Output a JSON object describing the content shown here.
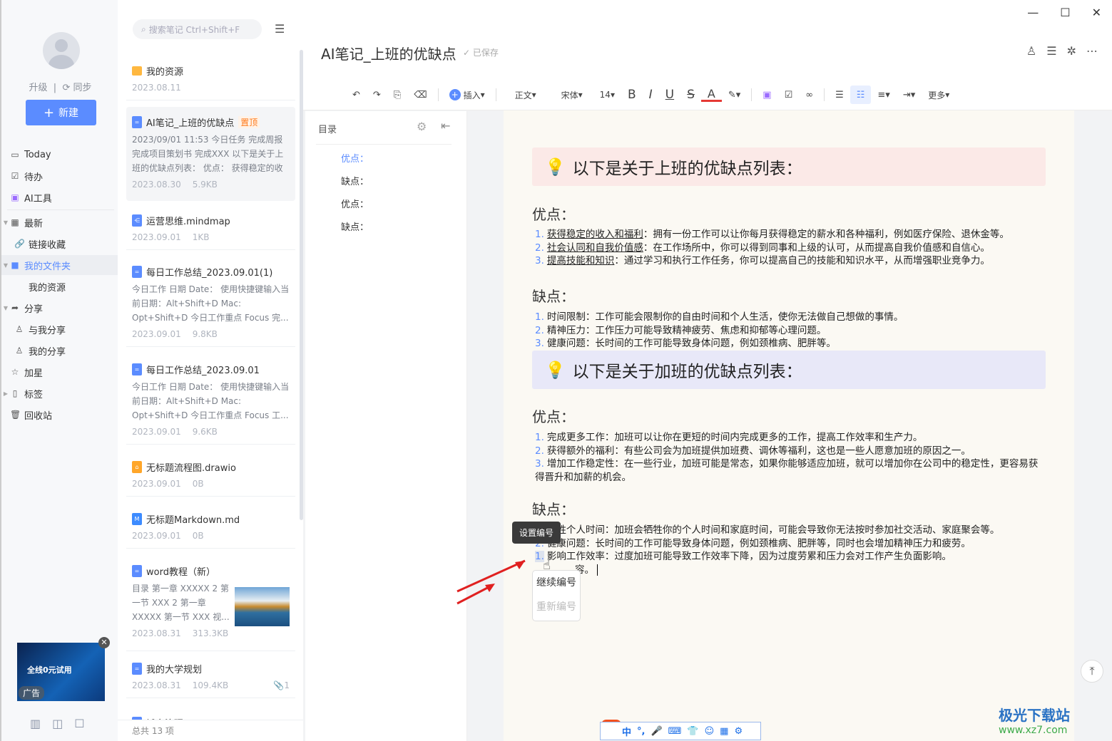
{
  "window": {
    "min": "—",
    "max": "☐",
    "close": "✕"
  },
  "nav": {
    "upgrade": "升级",
    "sync": "同步",
    "new": "新建",
    "items": [
      {
        "label": "Today",
        "icon": "calendar-icon"
      },
      {
        "label": "待办",
        "icon": "checkbox-icon"
      },
      {
        "label": "AI工具",
        "icon": "ai-icon"
      },
      {
        "label": "最新",
        "icon": "grid-icon"
      },
      {
        "label": "链接收藏",
        "icon": "link-icon"
      },
      {
        "label": "我的文件夹",
        "icon": "folder-icon"
      },
      {
        "label": "我的资源",
        "icon": ""
      },
      {
        "label": "分享",
        "icon": "share-icon"
      },
      {
        "label": "与我分享",
        "icon": "user-icon"
      },
      {
        "label": "我的分享",
        "icon": "user-icon"
      },
      {
        "label": "加星",
        "icon": "star-icon"
      },
      {
        "label": "标签",
        "icon": "tag-icon"
      },
      {
        "label": "回收站",
        "icon": "trash-icon"
      }
    ],
    "ad_label": "广告",
    "ad_text": "全线0元试用"
  },
  "list": {
    "search_placeholder": "搜索笔记 Ctrl+Shift+F",
    "footer": "总共 13 项",
    "notes": [
      {
        "title": "我的资源",
        "date": "2023.08.11",
        "size": "",
        "snippet": "",
        "type": "folder"
      },
      {
        "title": "AI笔记_上班的优缺点",
        "badge": "置顶",
        "snippet": "2023/09/01 11:53 今日任务 完成周报 完成项目策划书 完成XXX 以下是关于上班的优缺点列表： 优点： 获得稳定的收入...",
        "date": "2023.08.30",
        "size": "5.9KB",
        "type": "doc"
      },
      {
        "title": "运营思维.mindmap",
        "date": "2023.09.01",
        "size": "1KB",
        "snippet": "",
        "type": "mindmap"
      },
      {
        "title": "每日工作总结_2023.09.01(1)",
        "snippet": "今日工作 日期 Date： 使用快捷键输入当前日期：Alt+Shift+D Mac: Opt+Shift+D 今日工作重点 Focus 完...",
        "date": "2023.09.01",
        "size": "9.8KB",
        "type": "doc"
      },
      {
        "title": "每日工作总结_2023.09.01",
        "snippet": "今日工作 日期 Date： 使用快捷键输入当前日期：Alt+Shift+D Mac: Opt+Shift+D 今日工作重点 Focus 工...",
        "date": "2023.09.01",
        "size": "9.6KB",
        "type": "doc"
      },
      {
        "title": "无标题流程图.drawio",
        "date": "2023.09.01",
        "size": "0B",
        "snippet": "",
        "type": "drawio"
      },
      {
        "title": "无标题Markdown.md",
        "date": "2023.09.01",
        "size": "0B",
        "snippet": "",
        "type": "md"
      },
      {
        "title": "word教程（新）",
        "snippet": "目录 第一章 XXXXX 2 第一节 XXX 2 第一章 XXXXX 第一节 XXX 视...",
        "date": "2023.08.31",
        "size": "313.3KB",
        "type": "doc"
      },
      {
        "title": "我的大学规划",
        "date": "2023.08.31",
        "size": "109.4KB",
        "attach": "1",
        "snippet": "",
        "type": "doc"
      },
      {
        "title": "城市治理",
        "date": "",
        "size": "",
        "snippet": "",
        "type": "doc"
      }
    ]
  },
  "editor": {
    "title": "AI笔记_上班的优缺点",
    "saved": "已保存",
    "toolbar": {
      "insert": "插入",
      "style": "正文",
      "font": "宋体",
      "size": "14",
      "bold": "B",
      "italic": "I",
      "underline": "U",
      "strike": "S",
      "color": "A",
      "more": "更多"
    },
    "toc": {
      "heading": "目录",
      "items": [
        "优点：",
        "缺点：",
        "优点：",
        "缺点："
      ]
    },
    "banner1": "以下是关于上班的优缺点列表：",
    "banner2": "以下是关于加班的优缺点列表：",
    "h_pros": "优点：",
    "h_cons": "缺点：",
    "work_pros": [
      {
        "k": "获得稳定的收入和福利",
        "v": "：拥有一份工作可以让你每月获得稳定的薪水和各种福利，例如医疗保险、退休金等。"
      },
      {
        "k": "社会认同和自我价值感",
        "v": "：在工作场所中，你可以得到同事和上级的认可，从而提高自我价值感和自信心。"
      },
      {
        "k": "提高技能和知识",
        "v": "：通过学习和执行工作任务，你可以提高自己的技能和知识水平，从而增强职业竞争力。"
      }
    ],
    "work_cons": [
      "时间限制：工作可能会限制你的自由时间和个人生活，使你无法做自己想做的事情。",
      "精神压力：工作压力可能导致精神疲劳、焦虑和抑郁等心理问题。",
      "健康问题：长时间的工作可能导致身体问题，例如颈椎病、肥胖等。"
    ],
    "ot_pros": [
      "完成更多工作：加班可以让你在更短的时间内完成更多的工作，提高工作效率和生产力。",
      "获得额外的福利：有些公司会为加班提供加班费、调休等福利，这也是一些人愿意加班的原因之一。",
      "增加工作稳定性：在一些行业，加班可能是常态，如果你能够适应加班，就可以增加你在公司中的稳定性，更容易获得晋升和加薪的机会。"
    ],
    "ot_cons": [
      "牺牲个人时间：加班会牺牲你的个人时间和家庭时间，可能会导致你无法按时参加社交活动、家庭聚会等。",
      "健康问题：长时间的工作可能导致身体问题，例如颈椎病、肥胖等，同时也会增加精神压力和疲劳。",
      "影响工作效率：过度加班可能导致工作效率下降，因为过度劳累和压力会对工作产生负面影响。"
    ],
    "ot_cons_numbers": [
      "1.",
      "2.",
      "1."
    ],
    "trailing": "容。",
    "tooltip": "设置编号",
    "menu": [
      "继续编号",
      "重新编号"
    ]
  },
  "ime": {
    "items": [
      "中",
      "°,",
      "🎤",
      "⌨",
      "👕",
      "☺",
      "▦",
      "⚙"
    ]
  },
  "watermark": {
    "name": "极光下载站",
    "url": "www.xz7.com"
  },
  "colors": {
    "accent": "#5b8cff",
    "banner1": "#fbe9e7",
    "banner2": "#e8e8f8"
  }
}
